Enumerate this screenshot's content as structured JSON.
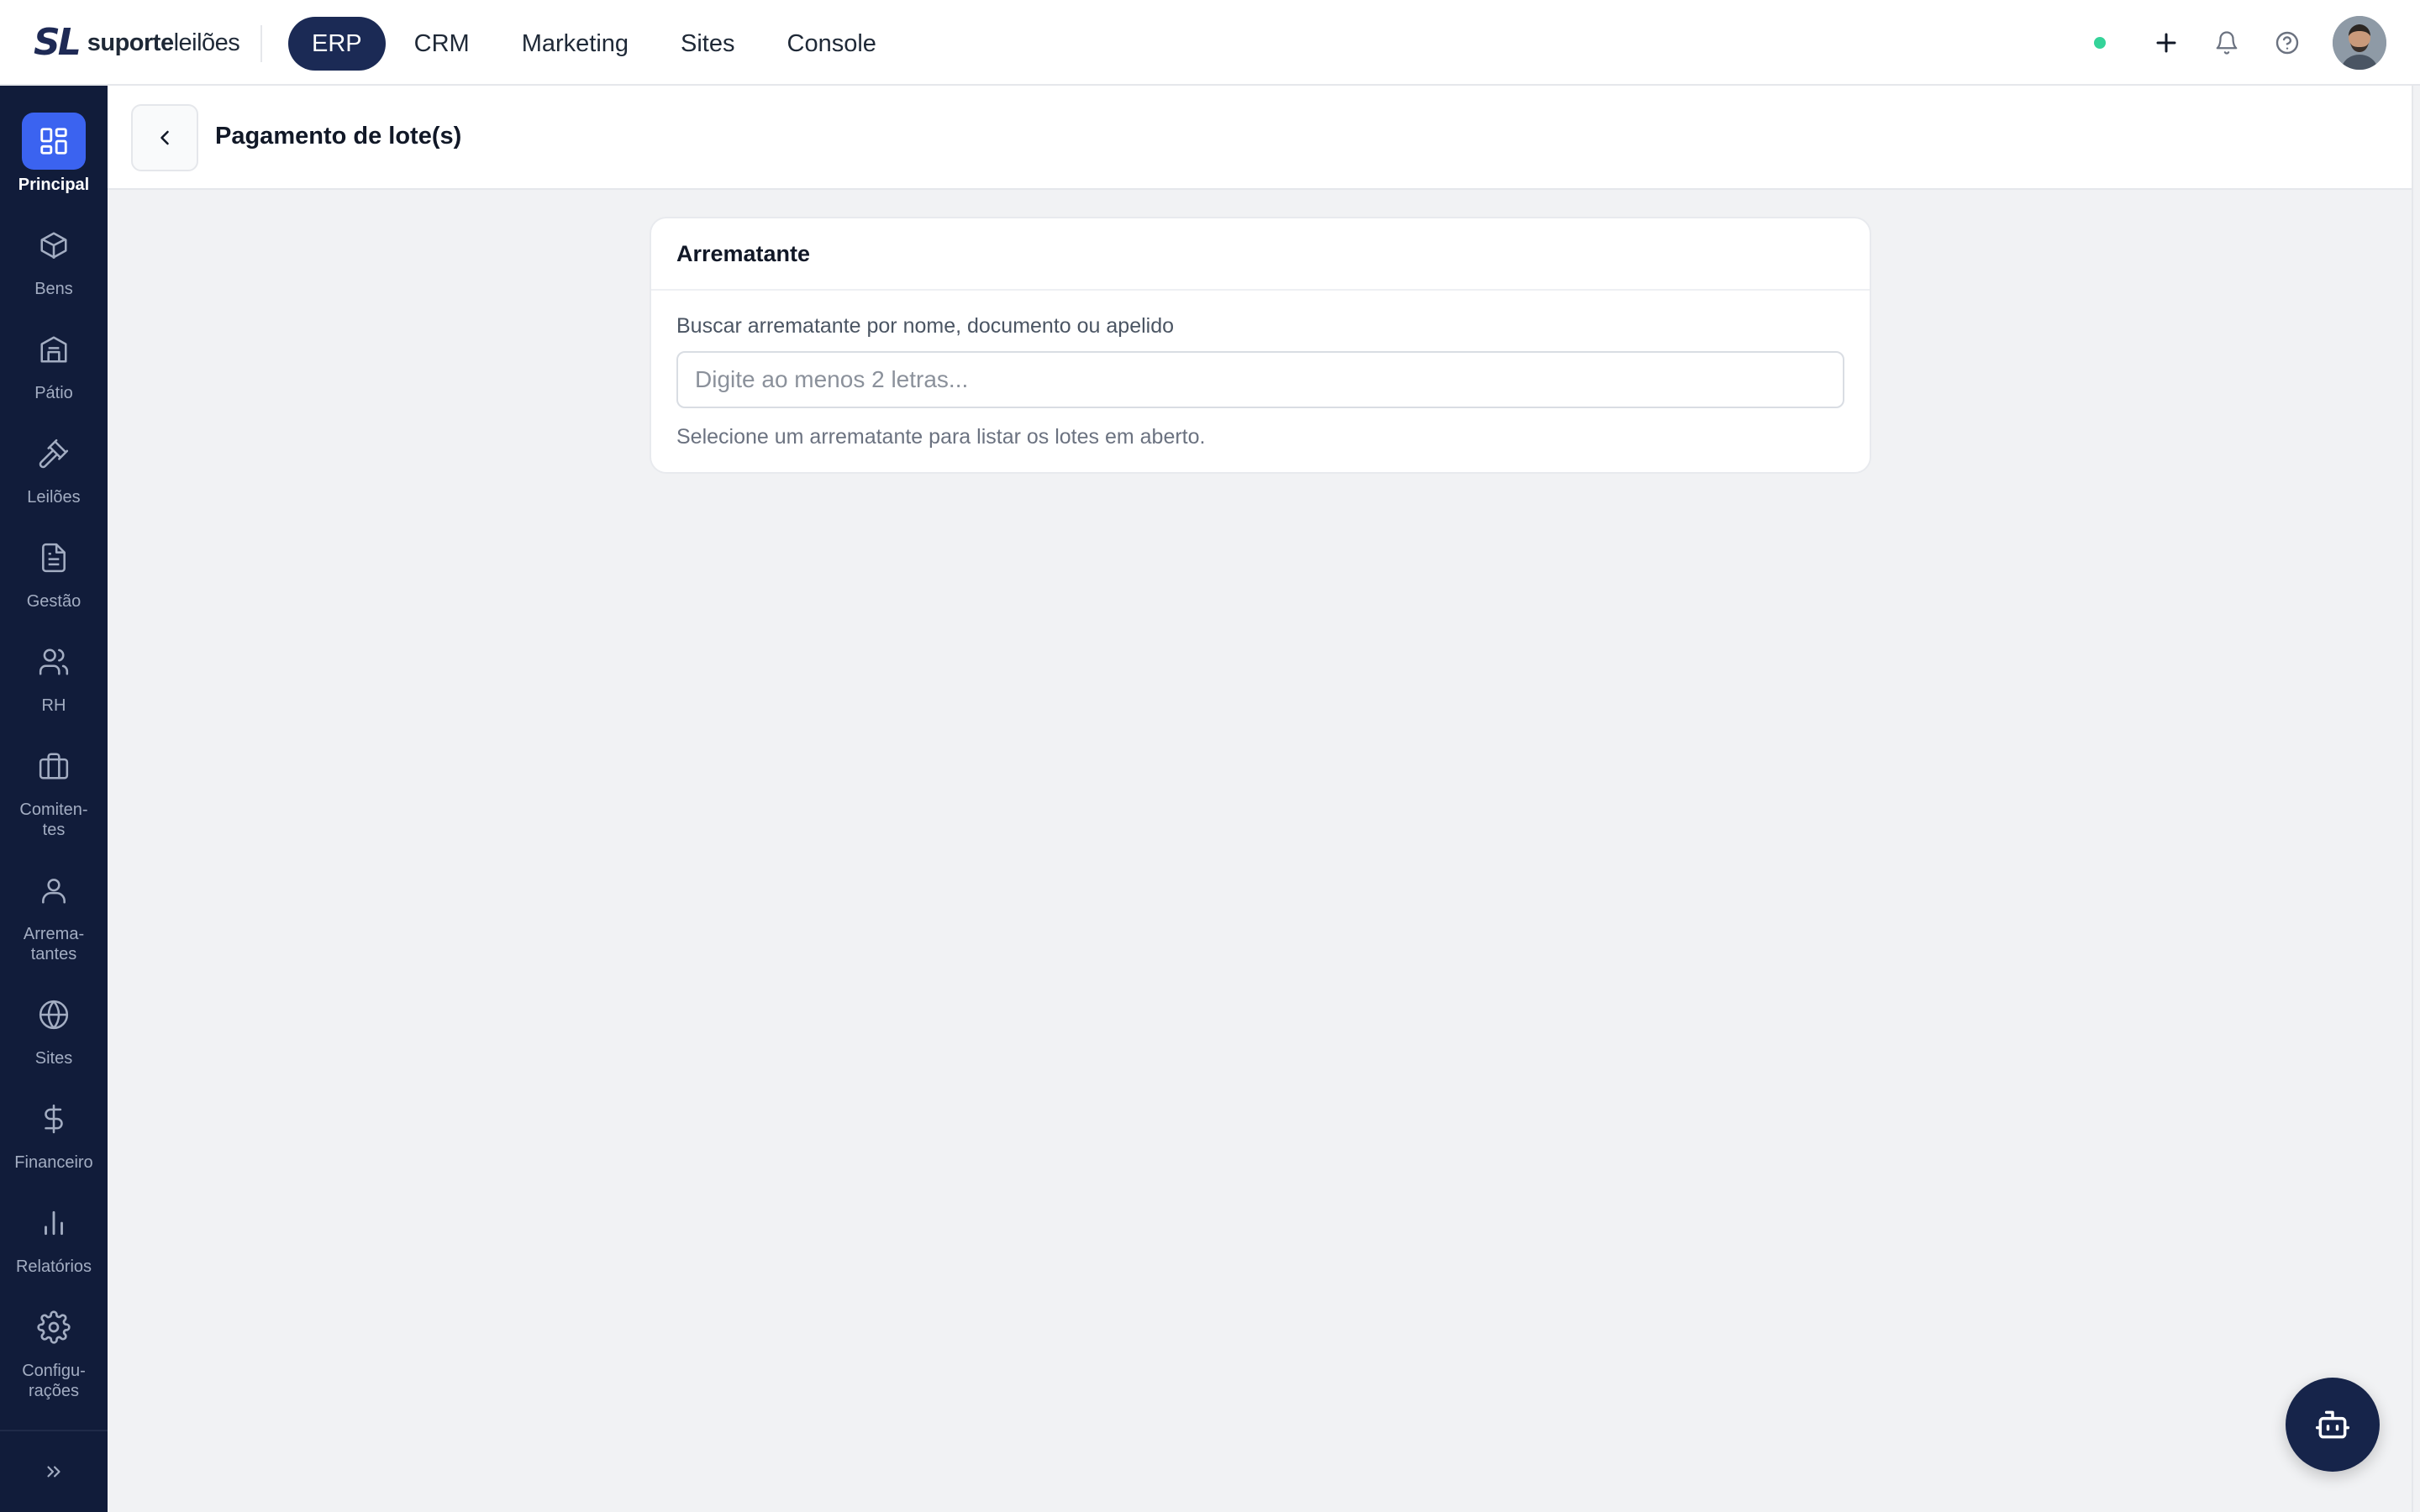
{
  "brand": {
    "mark": "SL",
    "name_bold": "suporte",
    "name_light": "leilões"
  },
  "topnav": {
    "tabs": [
      {
        "label": "ERP",
        "active": true
      },
      {
        "label": "CRM"
      },
      {
        "label": "Marketing"
      },
      {
        "label": "Sites"
      },
      {
        "label": "Console"
      }
    ]
  },
  "top_actions": {
    "status_color": "#34d399",
    "icons": [
      "plus-icon",
      "bell-icon",
      "help-icon"
    ]
  },
  "sidebar": {
    "items": [
      {
        "label": "Principal",
        "icon": "grid-icon",
        "active": true
      },
      {
        "label": "Bens",
        "icon": "box-icon"
      },
      {
        "label": "Pátio",
        "icon": "building-icon"
      },
      {
        "label": "Leilões",
        "icon": "gavel-icon"
      },
      {
        "label": "Gestão",
        "icon": "document-icon"
      },
      {
        "label": "RH",
        "icon": "users-icon"
      },
      {
        "label": "Comiten-\ntes",
        "icon": "briefcase-icon"
      },
      {
        "label": "Arrema-\ntantes",
        "icon": "user-icon"
      },
      {
        "label": "Sites",
        "icon": "globe-icon"
      },
      {
        "label": "Financeiro",
        "icon": "dollar-icon"
      },
      {
        "label": "Relatórios",
        "icon": "bar-chart-icon"
      },
      {
        "label": "Configu-\nrações",
        "icon": "gear-icon"
      }
    ]
  },
  "page": {
    "title": "Pagamento de lote(s)"
  },
  "card": {
    "title": "Arrematante",
    "field_label": "Buscar arrematante por nome, documento ou apelido",
    "search_value": "",
    "search_placeholder": "Digite ao menos 2 letras...",
    "hint": "Selecione um arrematante para listar os lotes em aberto."
  },
  "colors": {
    "sidebar_bg": "#111c3a",
    "accent": "#3b63f0",
    "nav_active": "#1b2a55"
  }
}
